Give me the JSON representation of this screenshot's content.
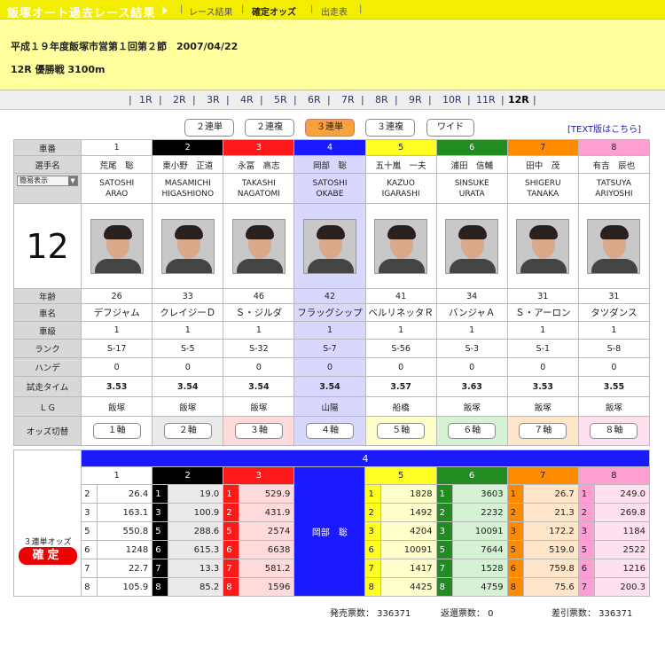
{
  "header": {
    "title": "飯塚オート過去レース結果",
    "nav": [
      "レース結果",
      "確定オッズ",
      "出走表"
    ]
  },
  "race_info": {
    "line1": "平成１９年度飯塚市営第１回第２節　2007/04/22",
    "line2": "12R 優勝戦 3100m"
  },
  "race_nav": [
    "1R",
    "2R",
    "3R",
    "4R",
    "5R",
    "6R",
    "7R",
    "8R",
    "9R",
    "10R",
    "11R",
    "12R"
  ],
  "race_nav_current": "12R",
  "bet_tabs": [
    "２連単",
    "２連複",
    "３連単",
    "３連複",
    "ワイド"
  ],
  "bet_tab_active": "３連単",
  "text_link": "[TEXT版はこちら]",
  "labels": {
    "car_no": "車番",
    "rider_name": "選手名",
    "display_select": "簡易表示",
    "race_no": "12",
    "age": "年齢",
    "car_name": "車名",
    "class": "車級",
    "rank": "ランク",
    "handicap": "ハンデ",
    "trial_time": "試走タイム",
    "lg": "ＬＧ",
    "odds_switch": "オッズ切替",
    "odds_title": "３連単オッズ",
    "kakutei": "確定"
  },
  "riders": [
    {
      "no": "1",
      "name": "荒尾　聡",
      "romaji1": "SATOSHI",
      "romaji2": "ARAO",
      "age": "26",
      "car": "デフジャム",
      "class": "1",
      "rank": "S-17",
      "hande": "0",
      "time": "3.53",
      "lg": "飯塚",
      "jiku": "１軸"
    },
    {
      "no": "2",
      "name": "東小野　正道",
      "romaji1": "MASAMICHI",
      "romaji2": "HIGASHIONO",
      "age": "33",
      "car": "クレイジーＤ",
      "class": "1",
      "rank": "S-5",
      "hande": "0",
      "time": "3.54",
      "lg": "飯塚",
      "jiku": "２軸"
    },
    {
      "no": "3",
      "name": "永冨　高志",
      "romaji1": "TAKASHI",
      "romaji2": "NAGATOMI",
      "age": "46",
      "car": "Ｓ・ジルダ",
      "class": "1",
      "rank": "S-32",
      "hande": "0",
      "time": "3.54",
      "lg": "飯塚",
      "jiku": "３軸"
    },
    {
      "no": "4",
      "name": "岡部　聡",
      "romaji1": "SATOSHI",
      "romaji2": "OKABE",
      "age": "42",
      "car": "フラッグシップ",
      "class": "1",
      "rank": "S-7",
      "hande": "0",
      "time": "3.54",
      "lg": "山陽",
      "jiku": "４軸"
    },
    {
      "no": "5",
      "name": "五十嵐　一夫",
      "romaji1": "KAZUO",
      "romaji2": "IGARASHI",
      "age": "41",
      "car": "ベルリネッタＲ",
      "class": "1",
      "rank": "S-56",
      "hande": "0",
      "time": "3.57",
      "lg": "船橋",
      "jiku": "５軸"
    },
    {
      "no": "6",
      "name": "浦田　信輔",
      "romaji1": "SINSUKE",
      "romaji2": "URATA",
      "age": "34",
      "car": "バンジャＡ",
      "class": "1",
      "rank": "S-3",
      "hande": "0",
      "time": "3.63",
      "lg": "飯塚",
      "jiku": "６軸"
    },
    {
      "no": "7",
      "name": "田中　茂",
      "romaji1": "SHIGERU",
      "romaji2": "TANAKA",
      "age": "31",
      "car": "Ｓ・アーロン",
      "class": "1",
      "rank": "S-1",
      "hande": "0",
      "time": "3.53",
      "lg": "飯塚",
      "jiku": "７軸"
    },
    {
      "no": "8",
      "name": "有吉　辰也",
      "romaji1": "TATSUYA",
      "romaji2": "ARIYOSHI",
      "age": "31",
      "car": "タツダンス",
      "class": "1",
      "rank": "S-8",
      "hande": "0",
      "time": "3.55",
      "lg": "飯塚",
      "jiku": "８軸"
    }
  ],
  "odds": {
    "axis": "4",
    "axis_rider": "岡部　聡",
    "columns": [
      {
        "no": "1",
        "rows": [
          [
            "2",
            "26.4"
          ],
          [
            "3",
            "163.1"
          ],
          [
            "5",
            "550.8"
          ],
          [
            "6",
            "1248"
          ],
          [
            "7",
            "22.7"
          ],
          [
            "8",
            "105.9"
          ]
        ]
      },
      {
        "no": "2",
        "rows": [
          [
            "1",
            "19.0"
          ],
          [
            "3",
            "100.9"
          ],
          [
            "5",
            "288.6"
          ],
          [
            "6",
            "615.3"
          ],
          [
            "7",
            "13.3"
          ],
          [
            "8",
            "85.2"
          ]
        ]
      },
      {
        "no": "3",
        "rows": [
          [
            "1",
            "529.9"
          ],
          [
            "2",
            "431.9"
          ],
          [
            "5",
            "2574"
          ],
          [
            "6",
            "6638"
          ],
          [
            "7",
            "581.2"
          ],
          [
            "8",
            "1596"
          ]
        ]
      },
      {
        "no": "5",
        "rows": [
          [
            "1",
            "1828"
          ],
          [
            "2",
            "1492"
          ],
          [
            "3",
            "4204"
          ],
          [
            "6",
            "10091"
          ],
          [
            "7",
            "1417"
          ],
          [
            "8",
            "4425"
          ]
        ]
      },
      {
        "no": "6",
        "rows": [
          [
            "1",
            "3603"
          ],
          [
            "2",
            "2232"
          ],
          [
            "3",
            "10091"
          ],
          [
            "5",
            "7644"
          ],
          [
            "7",
            "1528"
          ],
          [
            "8",
            "4759"
          ]
        ]
      },
      {
        "no": "7",
        "rows": [
          [
            "1",
            "26.7"
          ],
          [
            "2",
            "21.3"
          ],
          [
            "3",
            "172.2"
          ],
          [
            "5",
            "519.0"
          ],
          [
            "6",
            "759.8"
          ],
          [
            "8",
            "75.6"
          ]
        ]
      },
      {
        "no": "8",
        "rows": [
          [
            "1",
            "249.0"
          ],
          [
            "2",
            "269.8"
          ],
          [
            "3",
            "1184"
          ],
          [
            "5",
            "2522"
          ],
          [
            "6",
            "1216"
          ],
          [
            "7",
            "200.3"
          ]
        ]
      }
    ]
  },
  "footer": {
    "sales": "発売票数： 336371",
    "refund": "返還票数： 0",
    "net": "差引票数： 336371"
  }
}
